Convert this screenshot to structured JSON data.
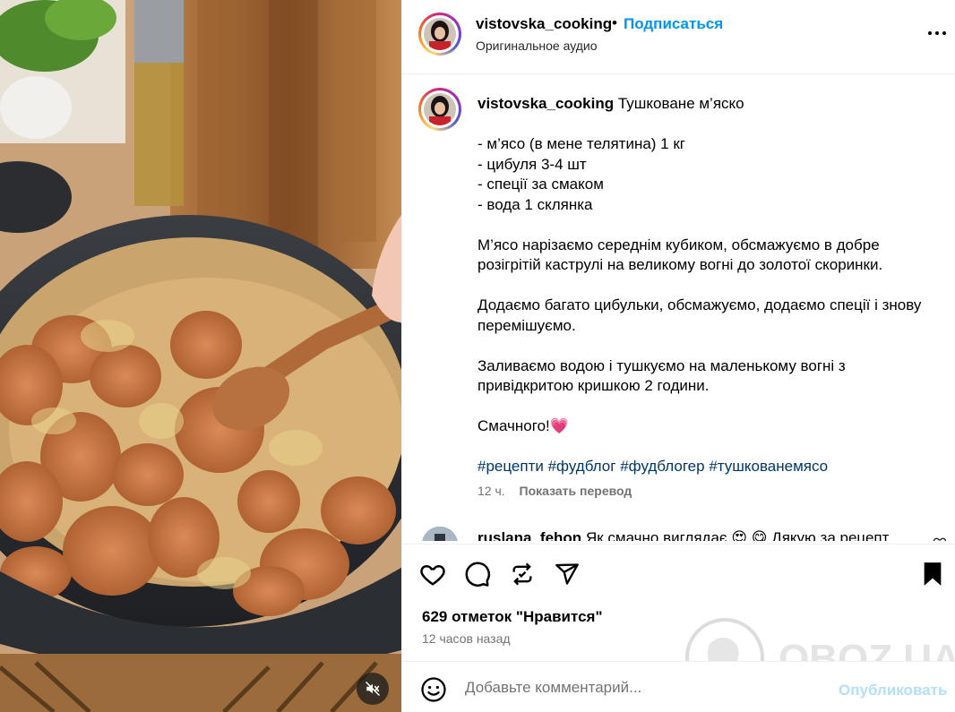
{
  "header": {
    "username": "vistovska_cooking",
    "separator": "•",
    "follow_label": "Подписаться",
    "audio_label": "Оригинальное аудио"
  },
  "caption": {
    "username": "vistovska_cooking",
    "title": "Тушковане м’яско",
    "ingredients": [
      "- м’ясо (в мене телятина) 1 кг",
      "- цибуля 3-4 шт",
      "- спеції за смаком",
      "- вода 1 склянка"
    ],
    "step1": "М’ясо нарізаємо середнім кубиком, обсмажуємо в добре розігрітій каструлі на великому вогні до золотої скоринки.",
    "step2": "Додаємо багато цибульки, обсмажуємо, додаємо спеції і знову перемішуємо.",
    "step3": "Заливаємо водою і тушкуємо на маленькому вогні з привідкритою кришкою 2 години.",
    "closing": "Смачного!",
    "closing_emoji": "💗",
    "hashtags": [
      "#рецепти",
      "#фудблог",
      "#фудблогер",
      "#тушкованемясо"
    ],
    "time_ago": "12 ч.",
    "translate_label": "Показать перевод"
  },
  "comment": {
    "username": "ruslana_fehon",
    "text": "Як смачно виглядає 😍 😋  Дякую за рецепт"
  },
  "actions": {
    "like_icon": "heart-icon",
    "comment_icon": "comment-icon",
    "repost_icon": "repost-icon",
    "share_icon": "share-icon",
    "save_icon": "bookmark-icon",
    "likes_text": "629 отметок \"Нравится\"",
    "posted_text": "12 часов назад"
  },
  "add_comment": {
    "placeholder": "Добавьте комментарий...",
    "publish_label": "Опубликовать"
  },
  "watermark": {
    "text": "OBOZ.UA"
  },
  "colors": {
    "follow_blue": "#0095f6",
    "hashtag_blue": "#00376b",
    "publish_disabled": "#b2dffc",
    "secondary_text": "#737373"
  }
}
